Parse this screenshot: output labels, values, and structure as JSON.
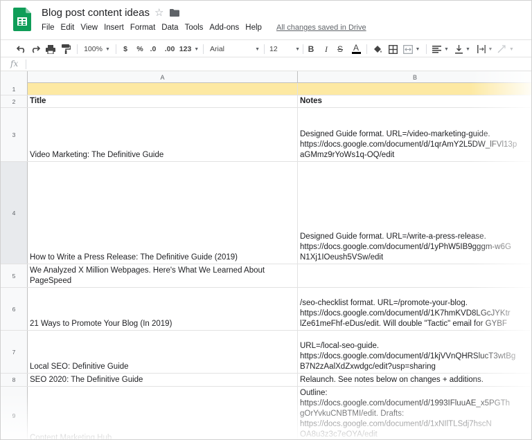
{
  "header": {
    "title": "Blog post content ideas",
    "saved_status": "All changes saved in Drive",
    "menu": [
      "File",
      "Edit",
      "View",
      "Insert",
      "Format",
      "Data",
      "Tools",
      "Add-ons",
      "Help"
    ]
  },
  "toolbar": {
    "zoom": "100%",
    "currency": "$",
    "percent": "%",
    "decrease_decimal": ".0",
    "increase_decimal": ".00",
    "more_formats": "123",
    "font": "Arial",
    "font_size": "12",
    "bold": "B",
    "italic": "I",
    "strikethrough": "S",
    "text_color": "A"
  },
  "formula_bar": {
    "label": "fx"
  },
  "columns": [
    "A",
    "B"
  ],
  "rows": [
    {
      "num": "1",
      "a": "",
      "b": ""
    },
    {
      "num": "2",
      "a": "Title",
      "b": "Notes"
    },
    {
      "num": "3",
      "a": "Video Marketing: The Definitive Guide",
      "b": "Designed Guide format. URL=/video-marketing-guide.\nhttps://docs.google.com/document/d/1qrAmY2L5DW_lFVl13p\naGMmz9rYoWs1q-OQ/edit"
    },
    {
      "num": "4",
      "a": "How to Write a Press Release: The Definitive Guide (2019)",
      "b": "Designed Guide format. URL=/write-a-press-release.\nhttps://docs.google.com/document/d/1yPhW5IB9gggm-w6G\nN1Xj1IOeush5VSw/edit"
    },
    {
      "num": "5",
      "a": "We Analyzed X Million Webpages. Here's What We Learned About\nPageSpeed",
      "b": ""
    },
    {
      "num": "6",
      "a": "21 Ways to Promote Your Blog (In 2019)",
      "b": "/seo-checklist format. URL=/promote-your-blog.\nhttps://docs.google.com/document/d/1K7hmKVD8LGcJYKtr\nlZe61meFhf-eDus/edit. Will double \"Tactic\" email for GYBF"
    },
    {
      "num": "7",
      "a": "Local SEO: Definitive Guide",
      "b": "URL=/local-seo-guide.\nhttps://docs.google.com/document/d/1kjVVnQHRSlucT3wtBg\nB7N2zAalXdZxwdgc/edit?usp=sharing"
    },
    {
      "num": "8",
      "a": "SEO 2020: The Definitive Guide",
      "b": "Relaunch. See notes below on changes + additions."
    },
    {
      "num": "9",
      "a": "Content Marketing Hub",
      "b": "Outline:\nhttps://docs.google.com/document/d/1993IFluuAE_x5PGTh\ngOrYvkuCNBTMI/edit. Drafts:\nhttps://docs.google.com/document/d/1xNIlTLSdj7hscN\nOA8u3z3c7eOYA/edit"
    }
  ],
  "colors": {
    "header_band": "#fde9a3",
    "sheets_green": "#0f9d58",
    "grid_line": "#e2e2e2"
  }
}
